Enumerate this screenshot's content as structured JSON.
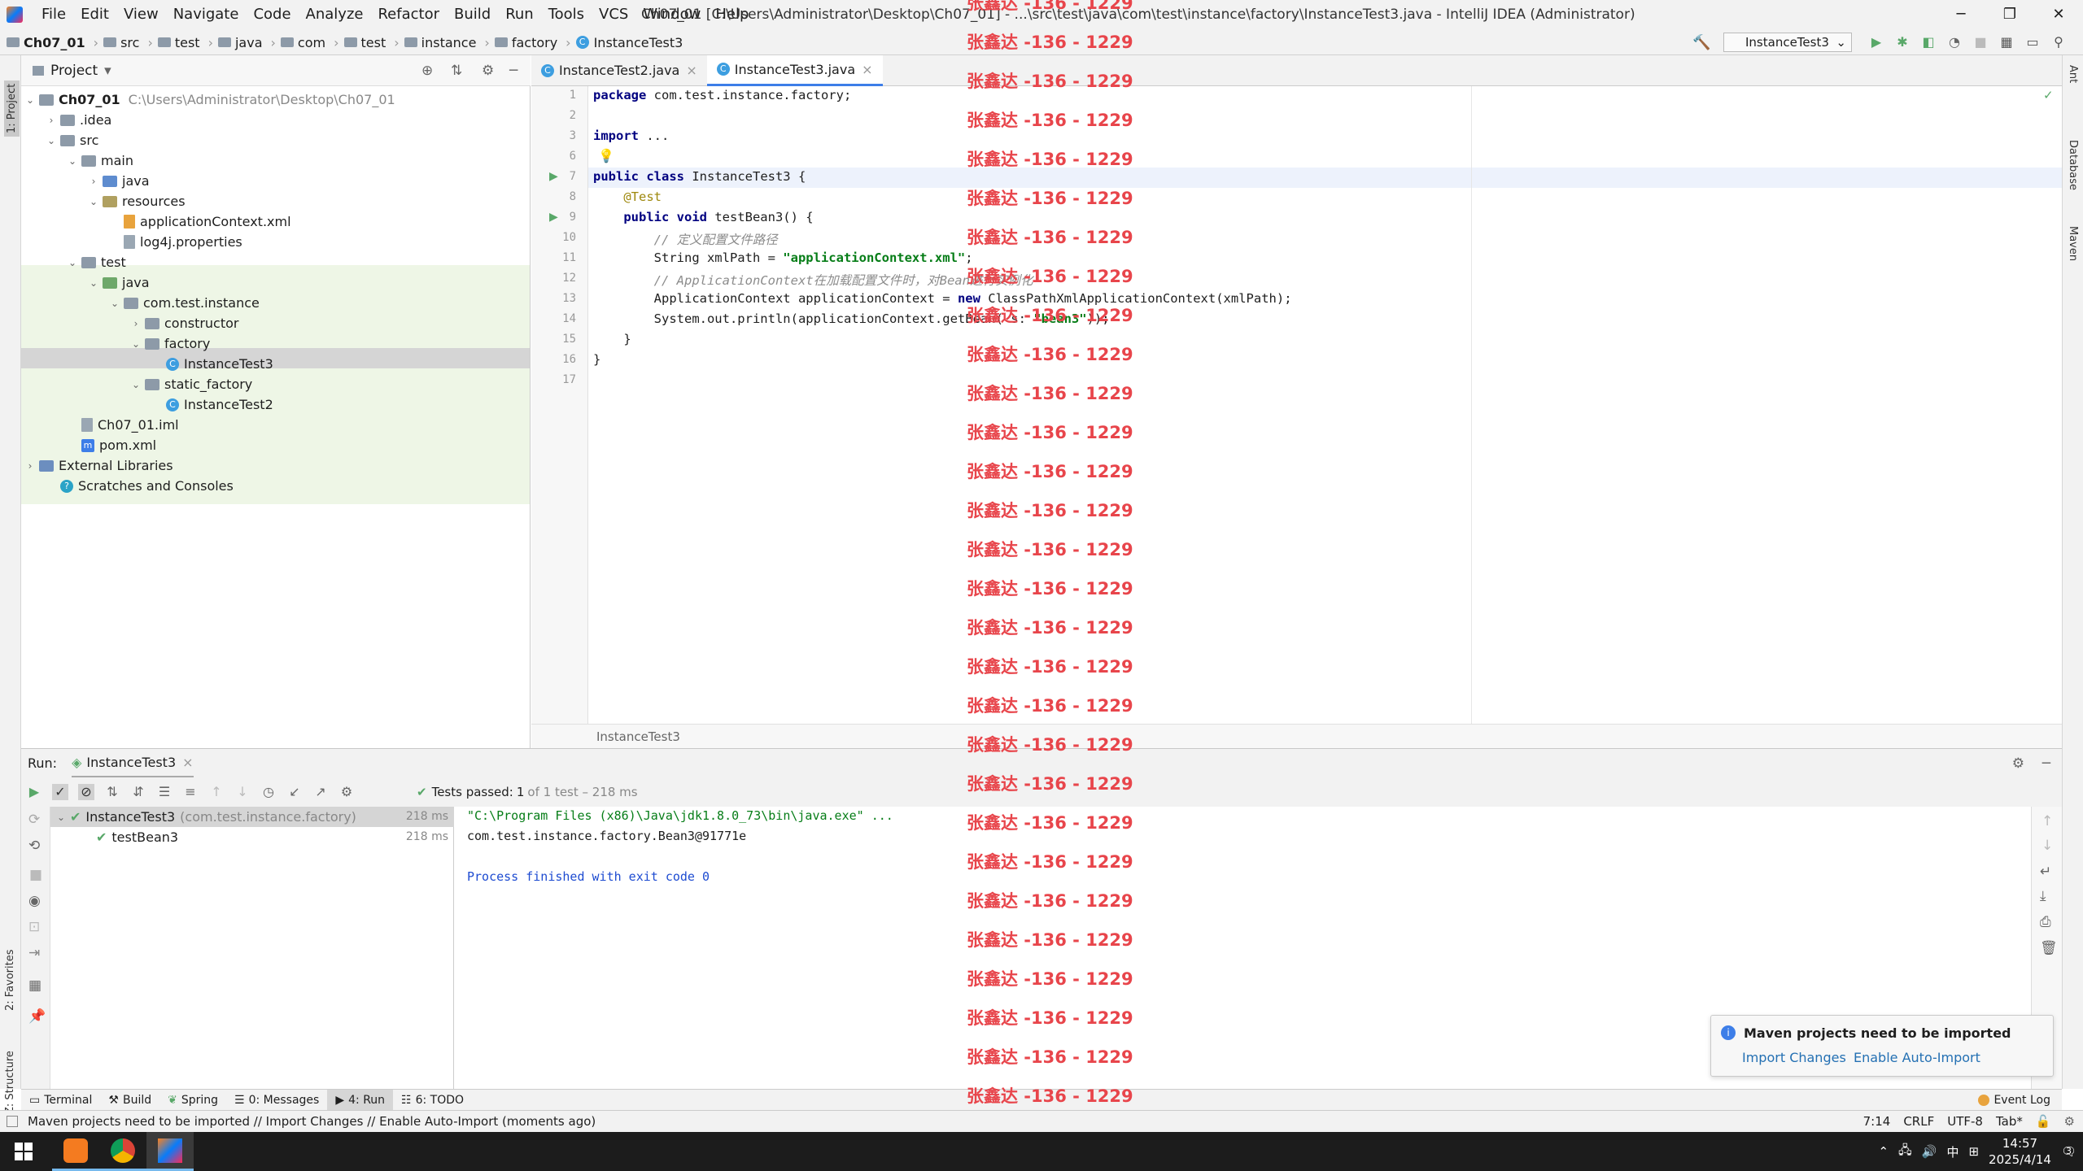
{
  "window": {
    "title": "Ch07_01 [C:\\Users\\Administrator\\Desktop\\Ch07_01] - ...\\src\\test\\java\\com\\test\\instance\\factory\\InstanceTest3.java - IntelliJ IDEA (Administrator)",
    "menu": [
      "File",
      "Edit",
      "View",
      "Navigate",
      "Code",
      "Analyze",
      "Refactor",
      "Build",
      "Run",
      "Tools",
      "VCS",
      "Window",
      "Help"
    ]
  },
  "breadcrumbs": [
    "Ch07_01",
    "src",
    "test",
    "java",
    "com",
    "test",
    "instance",
    "factory",
    "InstanceTest3"
  ],
  "run_config": "InstanceTest3",
  "project": {
    "header": "Project",
    "root_label": "Ch07_01",
    "root_path": "C:\\Users\\Administrator\\Desktop\\Ch07_01",
    "nodes": [
      ".idea",
      "src",
      "main",
      "java",
      "resources",
      "applicationContext.xml",
      "log4j.properties",
      "test",
      "java",
      "com.test.instance",
      "constructor",
      "factory",
      "InstanceTest3",
      "static_factory",
      "InstanceTest2",
      "Ch07_01.iml",
      "pom.xml",
      "External Libraries",
      "Scratches and Consoles"
    ]
  },
  "editor": {
    "tabs": [
      "InstanceTest2.java",
      "InstanceTest3.java"
    ],
    "line_numbers": [
      "1",
      "2",
      "3",
      "6",
      "7",
      "8",
      "9",
      "10",
      "11",
      "12",
      "13",
      "14",
      "15",
      "16",
      "17"
    ],
    "lines": [
      {
        "kw": "package ",
        "rest": "com.test.instance.factory;"
      },
      {
        "rest": ""
      },
      {
        "kw": "import ",
        "rest": "..."
      },
      {
        "rest": ""
      },
      {
        "kw": "public class ",
        "rest": "InstanceTest3 {"
      },
      {
        "ann": "    @Test"
      },
      {
        "kw": "    public void ",
        "rest": "testBean3() {"
      },
      {
        "cm": "        // 定义配置文件路径"
      },
      {
        "pre": "        String xmlPath = ",
        "str": "\"applicationContext.xml\"",
        "rest": ";"
      },
      {
        "cm": "        // ApplicationContext在加载配置文件时，对Bean进行实例化"
      },
      {
        "pre": "        ApplicationContext applicationContext = ",
        "kw": "new ",
        "rest": "ClassPathXmlApplicationContext(xmlPath);"
      },
      {
        "pre": "        System.out.println(applicationContext.getBean( s: ",
        "str": "\"bean3\"",
        "rest": "));"
      },
      {
        "rest": "    }"
      },
      {
        "rest": "}"
      },
      {
        "rest": ""
      }
    ],
    "breadcrumb": "InstanceTest3"
  },
  "run": {
    "label": "Run:",
    "tab": "InstanceTest3",
    "status_prefix": "Tests passed: ",
    "status_count": "1",
    "status_rest": " of 1 test – 218 ms",
    "tests": [
      {
        "name": "InstanceTest3",
        "pkg": "(com.test.instance.factory)",
        "time": "218 ms"
      },
      {
        "name": "testBean3",
        "pkg": "",
        "time": "218 ms"
      }
    ],
    "console": [
      "\"C:\\Program Files (x86)\\Java\\jdk1.8.0_73\\bin\\java.exe\" ...",
      "com.test.instance.factory.Bean3@91771e",
      "",
      "Process finished with exit code 0"
    ]
  },
  "notification": {
    "title": "Maven projects need to be imported",
    "action1": "Import Changes",
    "action2": "Enable Auto-Import"
  },
  "bottom_tabs": [
    "Terminal",
    "Build",
    "Spring",
    "0: Messages",
    "4: Run",
    "6: TODO"
  ],
  "event_log": "Event Log",
  "statusbar": {
    "message": "Maven projects need to be imported // Import Changes // Enable Auto-Import (moments ago)",
    "position": "7:14",
    "line_sep": "CRLF",
    "encoding": "UTF-8",
    "indent": "Tab*"
  },
  "side_labels": {
    "project": "1: Project",
    "favorites": "2: Favorites",
    "structure": "Z: Structure",
    "ant": "Ant",
    "database": "Database",
    "maven": "Maven"
  },
  "taskbar": {
    "time": "14:57",
    "date": "2025/4/14",
    "ime": "中",
    "notif_count": "3"
  },
  "watermark": "张鑫达 -136 - 1229",
  "colors": {
    "accent": "#3d7ee8",
    "success": "#59a869",
    "watermark": "#e8454b"
  }
}
